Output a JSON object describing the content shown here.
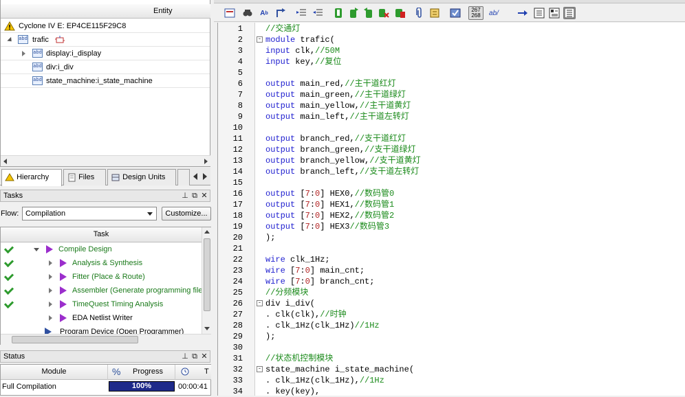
{
  "hierarchy": {
    "column_header": "Entity",
    "device": "Cyclone IV E: EP4CE115F29C8",
    "top": "trafic",
    "children": [
      "display:i_display",
      "div:i_div",
      "state_machine:i_state_machine"
    ],
    "tabs": [
      "Hierarchy",
      "Files",
      "Design Units"
    ]
  },
  "tasks": {
    "title": "Tasks",
    "flow_label": "Flow:",
    "flow_value": "Compilation",
    "customize_label": "Customize...",
    "column_header": "Task",
    "items": [
      {
        "label": "Compile Design",
        "done": true
      },
      {
        "label": "Analysis & Synthesis",
        "done": true
      },
      {
        "label": "Fitter (Place & Route)",
        "done": true
      },
      {
        "label": "Assembler (Generate programming files)",
        "done": true
      },
      {
        "label": "TimeQuest Timing Analysis",
        "done": true
      },
      {
        "label": "EDA Netlist Writer",
        "done": false
      },
      {
        "label": "Program Device (Open Programmer)",
        "done": false
      }
    ]
  },
  "status": {
    "title": "Status",
    "col_module": "Module",
    "col_percent": "%",
    "col_progress": "Progress",
    "row_module": "Full Compilation",
    "row_progress": "100%",
    "progress_fraction": 1.0,
    "row_time": "00:00:41"
  },
  "panel_buttons": {
    "pin": "⊥",
    "restore": "⧉",
    "close": "✕"
  },
  "toolbar": {
    "line_counter_top": "267",
    "line_counter_bottom": "268",
    "ab_label": "ab/"
  },
  "editor": {
    "start_line": 1,
    "lines": [
      [
        {
          "t": "//交通灯",
          "c": "cm"
        }
      ],
      [
        {
          "t": "module",
          "c": "kw"
        },
        {
          "t": " trafic("
        }
      ],
      [
        {
          "t": "input",
          "c": "kw"
        },
        {
          "t": " clk,"
        },
        {
          "t": "//50M",
          "c": "cm"
        }
      ],
      [
        {
          "t": "input",
          "c": "kw"
        },
        {
          "t": " key,"
        },
        {
          "t": "//复位",
          "c": "cm"
        }
      ],
      [],
      [
        {
          "t": "output",
          "c": "kw"
        },
        {
          "t": " main_red,"
        },
        {
          "t": "//主干道红灯",
          "c": "cm"
        }
      ],
      [
        {
          "t": "output",
          "c": "kw"
        },
        {
          "t": " main_green,"
        },
        {
          "t": "//主干道绿灯",
          "c": "cm"
        }
      ],
      [
        {
          "t": "output",
          "c": "kw"
        },
        {
          "t": " main_yellow,"
        },
        {
          "t": "//主干道黄灯",
          "c": "cm"
        }
      ],
      [
        {
          "t": "output",
          "c": "kw"
        },
        {
          "t": " main_left,"
        },
        {
          "t": "//主干道左转灯",
          "c": "cm"
        }
      ],
      [],
      [
        {
          "t": "output",
          "c": "kw"
        },
        {
          "t": " branch_red,"
        },
        {
          "t": "//支干道红灯",
          "c": "cm"
        }
      ],
      [
        {
          "t": "output",
          "c": "kw"
        },
        {
          "t": " branch_green,"
        },
        {
          "t": "//支干道绿灯",
          "c": "cm"
        }
      ],
      [
        {
          "t": "output",
          "c": "kw"
        },
        {
          "t": " branch_yellow,"
        },
        {
          "t": "//支干道黄灯",
          "c": "cm"
        }
      ],
      [
        {
          "t": "output",
          "c": "kw"
        },
        {
          "t": " branch_left,"
        },
        {
          "t": "//支干道左转灯",
          "c": "cm"
        }
      ],
      [],
      [
        {
          "t": "output",
          "c": "kw"
        },
        {
          "t": " ["
        },
        {
          "t": "7",
          "c": "num"
        },
        {
          "t": ":"
        },
        {
          "t": "0",
          "c": "num"
        },
        {
          "t": "] HEX0,"
        },
        {
          "t": "//数码管0",
          "c": "cm"
        }
      ],
      [
        {
          "t": "output",
          "c": "kw"
        },
        {
          "t": " ["
        },
        {
          "t": "7",
          "c": "num"
        },
        {
          "t": ":"
        },
        {
          "t": "0",
          "c": "num"
        },
        {
          "t": "] HEX1,"
        },
        {
          "t": "//数码管1",
          "c": "cm"
        }
      ],
      [
        {
          "t": "output",
          "c": "kw"
        },
        {
          "t": " ["
        },
        {
          "t": "7",
          "c": "num"
        },
        {
          "t": ":"
        },
        {
          "t": "0",
          "c": "num"
        },
        {
          "t": "] HEX2,"
        },
        {
          "t": "//数码管2",
          "c": "cm"
        }
      ],
      [
        {
          "t": "output",
          "c": "kw"
        },
        {
          "t": " ["
        },
        {
          "t": "7",
          "c": "num"
        },
        {
          "t": ":"
        },
        {
          "t": "0",
          "c": "num"
        },
        {
          "t": "] HEX3"
        },
        {
          "t": "//数码管3",
          "c": "cm"
        }
      ],
      [
        {
          "t": ");"
        }
      ],
      [],
      [
        {
          "t": "wire",
          "c": "kw"
        },
        {
          "t": " clk_1Hz;"
        }
      ],
      [
        {
          "t": "wire",
          "c": "kw"
        },
        {
          "t": " ["
        },
        {
          "t": "7",
          "c": "num"
        },
        {
          "t": ":"
        },
        {
          "t": "0",
          "c": "num"
        },
        {
          "t": "] main_cnt;"
        }
      ],
      [
        {
          "t": "wire",
          "c": "kw"
        },
        {
          "t": " ["
        },
        {
          "t": "7",
          "c": "num"
        },
        {
          "t": ":"
        },
        {
          "t": "0",
          "c": "num"
        },
        {
          "t": "] branch_cnt;"
        }
      ],
      [
        {
          "t": "//分频模块",
          "c": "cm"
        }
      ],
      [
        {
          "t": "div i_div("
        }
      ],
      [
        {
          "t": ". clk(clk),"
        },
        {
          "t": "//时钟",
          "c": "cm"
        }
      ],
      [
        {
          "t": ". clk_1Hz(clk_1Hz)"
        },
        {
          "t": "//1Hz",
          "c": "cm"
        }
      ],
      [
        {
          "t": ");"
        }
      ],
      [],
      [
        {
          "t": "//状态机控制模块",
          "c": "cm"
        }
      ],
      [
        {
          "t": "state_machine i_state_machine("
        }
      ],
      [
        {
          "t": ". clk_1Hz(clk_1Hz),"
        },
        {
          "t": "//1Hz",
          "c": "cm"
        }
      ],
      [
        {
          "t": ". key(key),"
        }
      ]
    ],
    "fold_lines": [
      2,
      26,
      32
    ]
  }
}
